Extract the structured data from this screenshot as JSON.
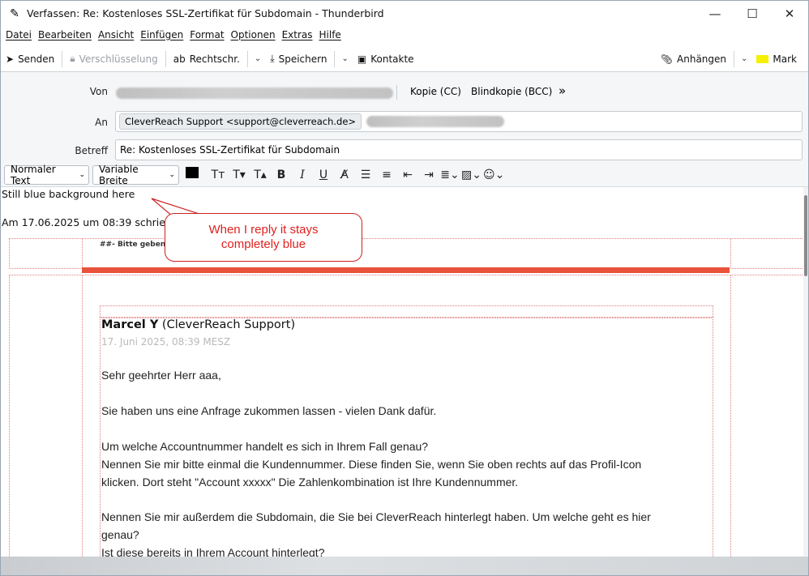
{
  "window": {
    "title": "Verfassen: Re: Kostenloses SSL-Zertifikat für Subdomain - Thunderbird",
    "controls": {
      "minimize": "—",
      "maximize": "☐",
      "close": "✕"
    }
  },
  "menu": [
    "Datei",
    "Bearbeiten",
    "Ansicht",
    "Einfügen",
    "Format",
    "Optionen",
    "Extras",
    "Hilfe"
  ],
  "toolbar": {
    "send": "Senden",
    "encryption": "Verschlüsselung",
    "spelling": "Rechtschr.",
    "save": "Speichern",
    "contacts": "Kontakte",
    "attach": "Anhängen",
    "mark": "Mark",
    "mark_color": "#f5f000"
  },
  "header": {
    "from_label": "Von",
    "cc": "Kopie (CC)",
    "bcc": "Blindkopie (BCC)",
    "more": "»",
    "to_label": "An",
    "to_recipient": "CleverReach Support <support@cleverreach.de>",
    "subject_label": "Betreff",
    "subject_value": "Re: Kostenloses SSL-Zertifikat für Subdomain"
  },
  "format": {
    "paragraph": "Normaler Text",
    "font": "Variable Breite",
    "text_color": "#000000"
  },
  "compose": {
    "first_line": "Still blue background here",
    "quote_header": "Am 17.06.2025 um 08:39 schrieb",
    "quoted_banner": "##- Bitte geben S",
    "sender_name": "Marcel Y",
    "sender_org": "(CleverReach Support)",
    "date": "17. Juni 2025, 08:39 MESZ",
    "lines": [
      "Sehr geehrter Herr aaa,",
      "Sie haben uns eine Anfrage zukommen lassen - vielen Dank dafür.",
      "Um welche Accountnummer handelt es sich in Ihrem Fall genau?",
      "Nennen Sie mir bitte einmal die Kundennummer. Diese finden Sie, wenn Sie oben rechts auf das Profil-Icon",
      "klicken. Dort steht \"Account xxxxx\" Die Zahlenkombination ist Ihre Kundennummer.",
      "Nennen Sie mir außerdem die Subdomain, die Sie bei CleverReach hinterlegt haben. Um welche geht es hier",
      "genau?",
      "Ist diese bereits in Ihrem Account hinterlegt?"
    ]
  },
  "annotation": {
    "line1": "When I reply it stays",
    "line2": "completely blue",
    "color": "#e02020"
  }
}
